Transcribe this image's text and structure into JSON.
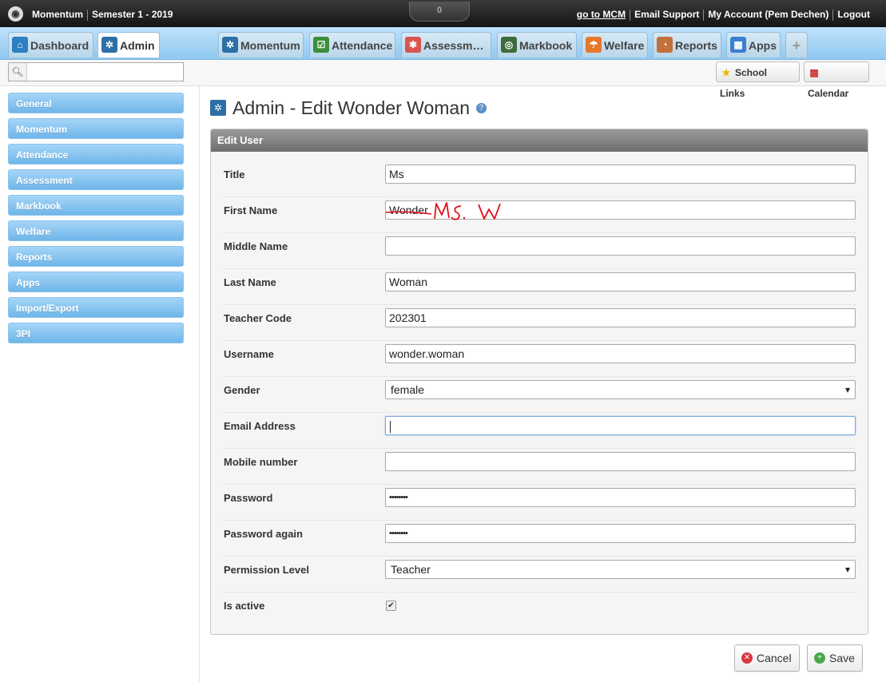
{
  "topbar": {
    "app_name": "Momentum",
    "semester": "Semester 1 - 2019",
    "notification_count": "0",
    "links": [
      "go to MCM",
      "Email Support",
      "My Account (Pem Dechen)",
      "Logout"
    ]
  },
  "tabs": {
    "left": [
      {
        "label": "Dashboard",
        "icon": "home-icon",
        "color": "#2d7fc1"
      },
      {
        "label": "Admin",
        "icon": "gears-icon",
        "color": "#2d6fa6"
      }
    ],
    "right": [
      {
        "label": "Momentum",
        "icon": "gear-icon",
        "color": "#2d6fa6"
      },
      {
        "label": "Attendance",
        "icon": "checklist-icon",
        "color": "#3a8f3a"
      },
      {
        "label": "Assessm…",
        "icon": "assessment-icon",
        "color": "#d9534f"
      },
      {
        "label": "Markbook",
        "icon": "target-icon",
        "color": "#3d6b3d"
      },
      {
        "label": "Welfare",
        "icon": "umbrella-icon",
        "color": "#e8772e"
      },
      {
        "label": "Reports",
        "icon": "chart-icon",
        "color": "#c0703a"
      },
      {
        "label": "Apps",
        "icon": "grid-icon",
        "color": "#3a7fd0"
      }
    ],
    "add_label": "+"
  },
  "toolbar": {
    "search_placeholder": "",
    "school_links_label": "School Links",
    "calendar_label": "Calendar"
  },
  "sidebar": {
    "items": [
      "General",
      "Momentum",
      "Attendance",
      "Assessment",
      "Markbook",
      "Welfare",
      "Reports",
      "Apps",
      "Import/Export",
      "3PI"
    ]
  },
  "page": {
    "title": "Admin - Edit Wonder Woman"
  },
  "panel": {
    "header": "Edit User",
    "fields": [
      {
        "label": "Title",
        "value": "Ms",
        "type": "text"
      },
      {
        "label": "First Name",
        "value": "Wonder",
        "type": "text",
        "annotation": "Ms. W"
      },
      {
        "label": "Middle Name",
        "value": "",
        "type": "text"
      },
      {
        "label": "Last Name",
        "value": "Woman",
        "type": "text"
      },
      {
        "label": "Teacher Code",
        "value": "202301",
        "type": "text"
      },
      {
        "label": "Username",
        "value": "wonder.woman",
        "type": "text"
      },
      {
        "label": "Gender",
        "value": "female",
        "type": "select"
      },
      {
        "label": "Email Address",
        "value": "",
        "type": "text",
        "focused": true
      },
      {
        "label": "Mobile number",
        "value": "",
        "type": "text"
      },
      {
        "label": "Password",
        "value": "••••••••",
        "type": "password"
      },
      {
        "label": "Password again",
        "value": "••••••••",
        "type": "password"
      },
      {
        "label": "Permission Level",
        "value": "Teacher",
        "type": "select"
      },
      {
        "label": "Is active",
        "value": "✔",
        "type": "checkbox",
        "checked": true
      }
    ]
  },
  "actions": {
    "cancel_label": "Cancel",
    "save_label": "Save"
  },
  "colors": {
    "annotation_red": "#e0101a",
    "sidebar_blue": "#6eb6ea",
    "topbar_dark": "#1c1c1c"
  }
}
